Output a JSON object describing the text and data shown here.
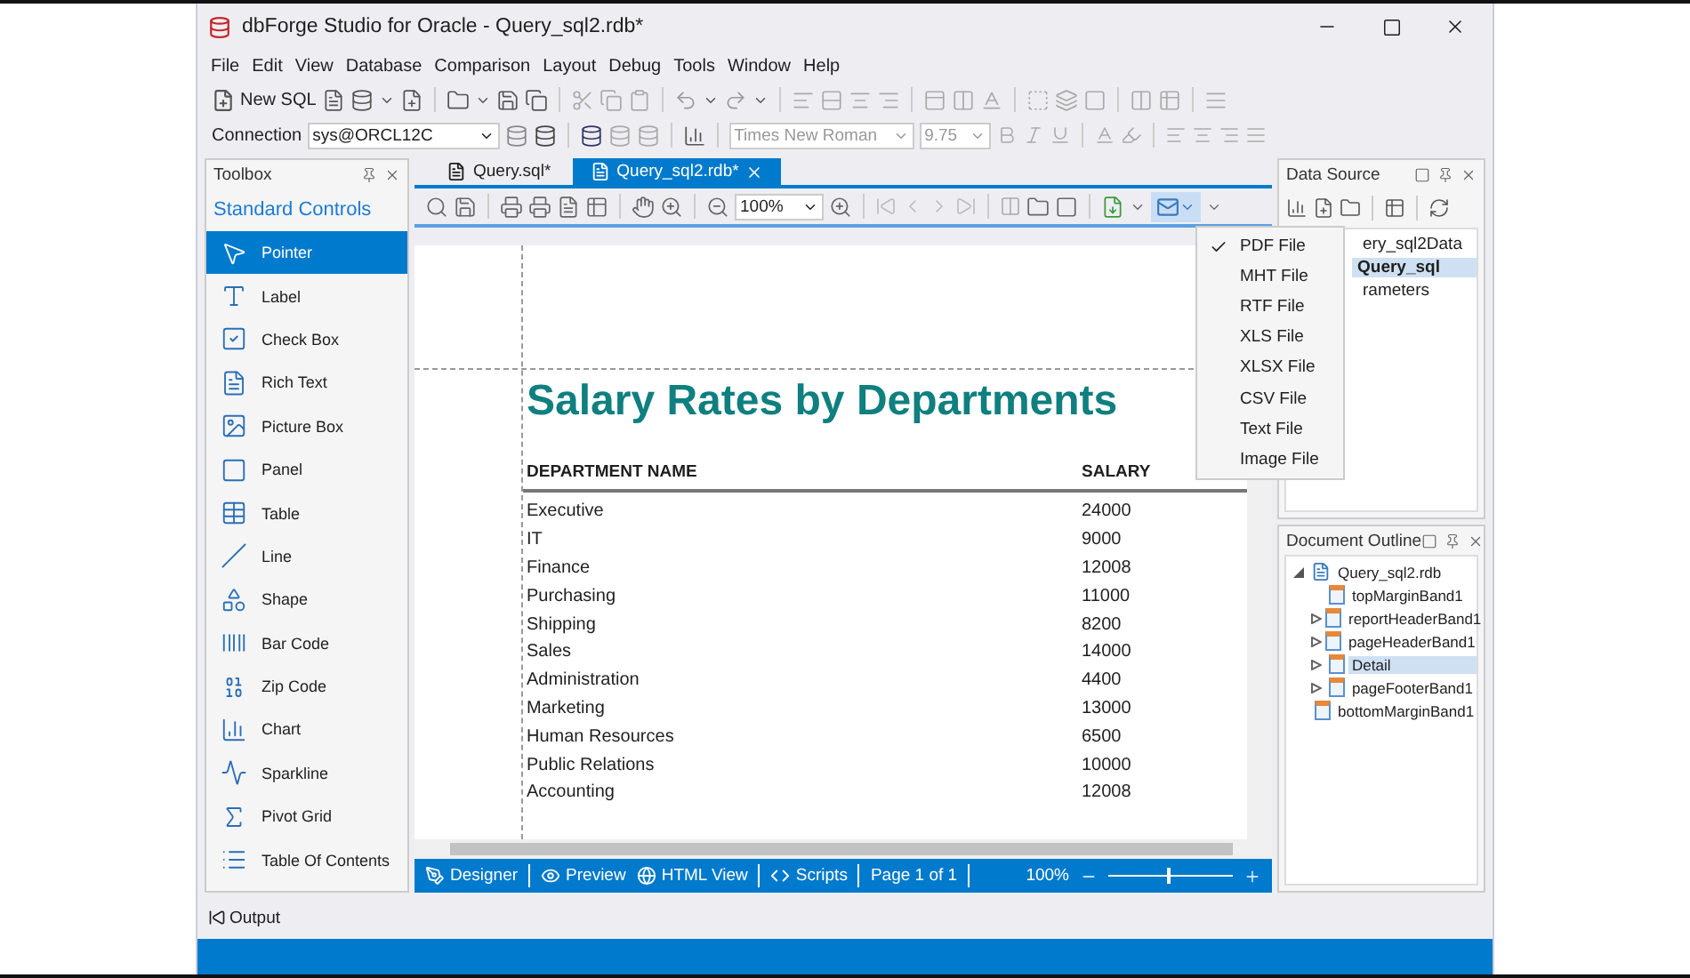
{
  "window": {
    "title": "dbForge Studio for Oracle - Query_sql2.rdb*"
  },
  "menu": [
    "File",
    "Edit",
    "View",
    "Database",
    "Comparison",
    "Layout",
    "Debug",
    "Tools",
    "Window",
    "Help"
  ],
  "toolbar": {
    "new_sql": "New SQL",
    "connection_label": "Connection",
    "connection": "sys@ORCL12C",
    "font": "Times New Roman",
    "font_size": "9.75"
  },
  "toolbox": {
    "title": "Toolbox",
    "group": "Standard Controls",
    "items": [
      {
        "label": "Pointer",
        "selected": true
      },
      {
        "label": "Label",
        "selected": false
      },
      {
        "label": "Check Box",
        "selected": false
      },
      {
        "label": "Rich Text",
        "selected": false
      },
      {
        "label": "Picture Box",
        "selected": false
      },
      {
        "label": "Panel",
        "selected": false
      },
      {
        "label": "Table",
        "selected": false
      },
      {
        "label": "Line",
        "selected": false
      },
      {
        "label": "Shape",
        "selected": false
      },
      {
        "label": "Bar Code",
        "selected": false
      },
      {
        "label": "Zip Code",
        "selected": false
      },
      {
        "label": "Chart",
        "selected": false
      },
      {
        "label": "Sparkline",
        "selected": false
      },
      {
        "label": "Pivot Grid",
        "selected": false
      },
      {
        "label": "Table Of Contents",
        "selected": false
      }
    ]
  },
  "tabs": [
    {
      "label": "Query.sql*",
      "selected": false
    },
    {
      "label": "Query_sql2.rdb*",
      "selected": true
    }
  ],
  "preview_toolbar": {
    "zoom": "100%"
  },
  "report": {
    "title": "Salary Rates by Departments",
    "columns": [
      "DEPARTMENT NAME",
      "SALARY"
    ],
    "rows": [
      [
        "Executive",
        "24000"
      ],
      [
        "IT",
        "9000"
      ],
      [
        "Finance",
        "12008"
      ],
      [
        "Purchasing",
        "11000"
      ],
      [
        "Shipping",
        "8200"
      ],
      [
        "Sales",
        "14000"
      ],
      [
        "Administration",
        "4400"
      ],
      [
        "Marketing",
        "13000"
      ],
      [
        "Human Resources",
        "6500"
      ],
      [
        "Public Relations",
        "10000"
      ],
      [
        "Accounting",
        "12008"
      ]
    ]
  },
  "export_menu": [
    {
      "label": "PDF File",
      "checked": true
    },
    {
      "label": "MHT File",
      "checked": false
    },
    {
      "label": "RTF File",
      "checked": false
    },
    {
      "label": "XLS File",
      "checked": false
    },
    {
      "label": "XLSX File",
      "checked": false
    },
    {
      "label": "CSV File",
      "checked": false
    },
    {
      "label": "Text File",
      "checked": false
    },
    {
      "label": "Image File",
      "checked": false
    }
  ],
  "bottom_bar": {
    "tabs": [
      "Designer",
      "Preview",
      "HTML View",
      "Scripts"
    ],
    "page": "Page 1 of 1",
    "zoom": "100%",
    "zoom_slider": {
      "level": 0.47
    }
  },
  "data_source": {
    "title": "Data Source",
    "items": [
      {
        "label": "ery_sql2Data",
        "selected": false
      },
      {
        "label": "Query_sql",
        "selected": true
      },
      {
        "label": "rameters",
        "selected": false
      }
    ]
  },
  "document_outline": {
    "title": "Document Outline",
    "root": {
      "label": "Query_sql2.rdb",
      "expanded": true,
      "selected": false,
      "children": [
        {
          "label": "topMarginBand1",
          "expandable": false,
          "selected": false
        },
        {
          "label": "reportHeaderBand1",
          "expandable": true,
          "selected": false
        },
        {
          "label": "pageHeaderBand1",
          "expandable": true,
          "selected": false
        },
        {
          "label": "Detail",
          "expandable": true,
          "selected": true
        },
        {
          "label": "pageFooterBand1",
          "expandable": true,
          "selected": false
        },
        {
          "label": "bottomMarginBand1",
          "expandable": false,
          "selected": false
        }
      ]
    }
  },
  "output": {
    "label": "Output"
  }
}
